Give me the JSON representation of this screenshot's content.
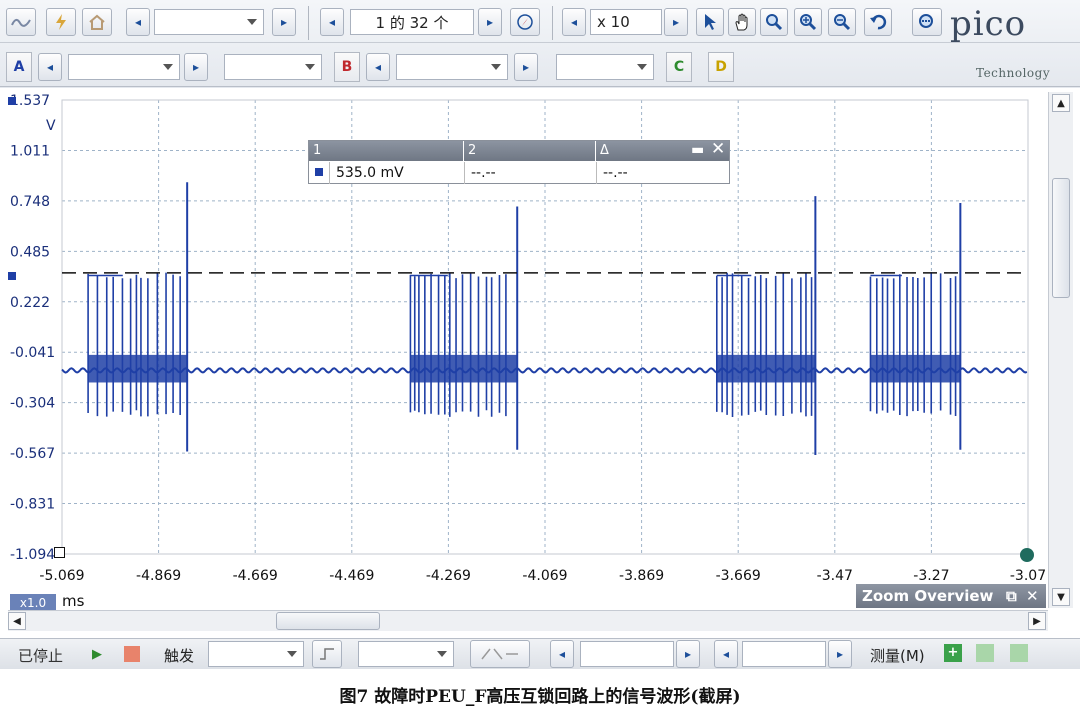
{
  "toolbar": {
    "capture_nav": "1 的 32 个",
    "zoom_value": "x 10",
    "channel_a_label": "A",
    "channel_b_label": "B",
    "channel_c_label": "C",
    "channel_d_label": "D",
    "logo_main": "pico",
    "logo_sub": "Technology",
    "icons": [
      "scope-mode-icon",
      "lightning-icon",
      "home-icon",
      "arrow-left-icon",
      "arrow-right-icon",
      "compass-icon",
      "pointer-icon",
      "hand-icon",
      "zoom-in-icon",
      "zoom-out-icon",
      "undo-icon",
      "zoom-fit-icon"
    ]
  },
  "colors": {
    "trace": "#1f3fa6",
    "grid": "#9fb3c8",
    "accent": "#1d4f9a",
    "channel_a": "#1f3fa6",
    "channel_b": "#c0282d",
    "channel_c": "#2e8b2e",
    "channel_d": "#c8a200"
  },
  "chart_data": {
    "type": "line",
    "title": "",
    "xlabel": "ms",
    "ylabel": "V",
    "xlim": [
      -5.069,
      -3.07
    ],
    "ylim": [
      -1.094,
      1.537
    ],
    "y_ticks": [
      "1.537",
      "1.011",
      "0.748",
      "0.485",
      "0.222",
      "-0.041",
      "-0.304",
      "-0.567",
      "-0.831",
      "-1.094"
    ],
    "x_ticks": [
      "-5.069",
      "-4.869",
      "-4.669",
      "-4.469",
      "-4.269",
      "-4.069",
      "-3.869",
      "-3.669",
      "-3.47",
      "-3.27",
      "-3.07"
    ],
    "ruler_level": 0.535,
    "baseline": -0.03,
    "burst_high": 0.52,
    "burst_low": -0.28,
    "bursts": [
      {
        "start": -5.015,
        "end": -4.81,
        "spike_x": -4.81,
        "spike_high": 1.06,
        "spike_low": -0.5
      },
      {
        "start": -4.348,
        "end": -4.127,
        "spike_x": -4.127,
        "spike_high": 0.92,
        "spike_low": -0.49
      },
      {
        "start": -3.714,
        "end": -3.51,
        "spike_x": -3.51,
        "spike_high": 0.98,
        "spike_low": -0.52
      },
      {
        "start": -3.396,
        "end": -3.21,
        "spike_x": -3.21,
        "spike_high": 0.94,
        "spike_low": -0.49
      }
    ],
    "grid": true,
    "unit_scale": "x1.0",
    "x_unit": "ms"
  },
  "measurement": {
    "col1": "1",
    "col2": "2",
    "col3": "Δ",
    "val1": "535.0 mV",
    "val2": "--.--",
    "val3": "--.--"
  },
  "zoom_overview": {
    "title": "Zoom Overview"
  },
  "status": {
    "state": "已停止",
    "trigger": "触发",
    "measure": "测量(M)"
  },
  "caption": "图7   故障时PEU_F高压互锁回路上的信号波形(截屏)"
}
